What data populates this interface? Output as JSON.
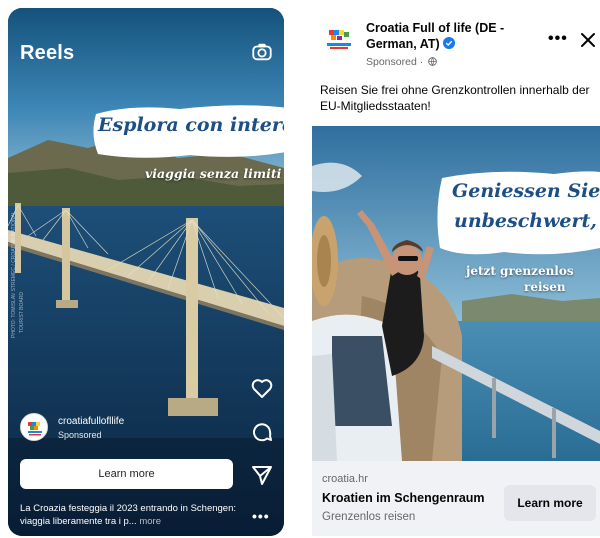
{
  "reels": {
    "header_title": "Reels",
    "camera_icon": "camera-icon",
    "overlay_headline": "Esplora con interesse,",
    "overlay_subline": "viaggia senza limiti",
    "photo_credit": "PHOTO: TOMISLAV STREMEC / CROATIAN NATIONAL",
    "photo_credit2": "TOURIST BOARD",
    "account_name": "croatiafullofllife",
    "sponsored": "Sponsored",
    "cta": "Learn more",
    "caption": "La Croazia festeggia il 2023 entrando in Schengen: viaggia liberamente tra i p...",
    "caption_more": " more",
    "actions": [
      "heart-icon",
      "comment-icon",
      "send-icon",
      "more-dots-icon"
    ],
    "more_dots": "•••"
  },
  "facebook_ad": {
    "page_name": "Croatia Full of life (DE - German, AT)",
    "sponsored": "Sponsored ·",
    "body_text": "Reisen Sie frei ohne Grenzkontrollen innerhalb der EU-Mitgliedsstaaten!",
    "overlay_headline_line1": "Geniessen Sie",
    "overlay_headline_line2": "unbeschwert,",
    "overlay_subline_line1": "jetzt grenzenlos",
    "overlay_subline_line2": "reisen",
    "link_domain": "croatia.hr",
    "link_headline": "Kroatien im Schengenraum",
    "link_description": "Grenzenlos reisen",
    "cta": "Learn more",
    "more_dots": "•••",
    "icons": [
      "verified-badge-icon",
      "globe-icon",
      "close-icon"
    ]
  },
  "colors": {
    "brush_text_blue": "#1b4f86",
    "fb_grey_bg": "#f0f2f5",
    "fb_button": "#e4e6eb",
    "verified_blue": "#1877f2"
  }
}
